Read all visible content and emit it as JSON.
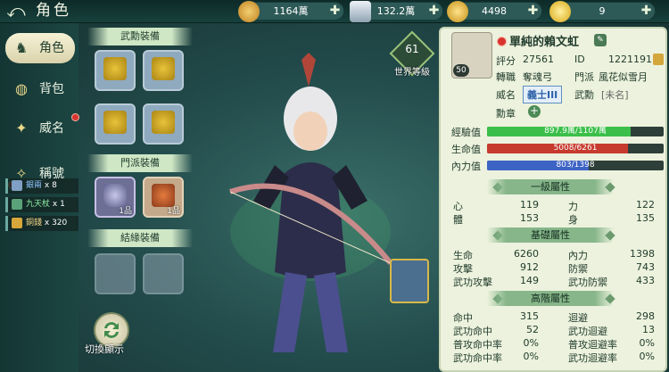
{
  "header": {
    "back_glyph": "⤺",
    "title": "角色"
  },
  "currencies": [
    {
      "name": "coin",
      "value": "1164萬",
      "color": "#e0a23a"
    },
    {
      "name": "silver",
      "value": "132.2萬",
      "color": "#c5d2dc"
    },
    {
      "name": "gold-ingot",
      "value": "4498",
      "color": "#e6b52c"
    },
    {
      "name": "yuanbao",
      "value": "9",
      "color": "#f2c12c"
    }
  ],
  "nav": [
    {
      "label": "角色",
      "icon": "person-icon",
      "glyph": "♞",
      "active": true
    },
    {
      "label": "背包",
      "icon": "bag-icon",
      "glyph": "◍"
    },
    {
      "label": "威名",
      "icon": "fame-icon",
      "glyph": "✦",
      "badge": true
    },
    {
      "label": "稱號",
      "icon": "title-icon",
      "glyph": "✧"
    }
  ],
  "loot": [
    {
      "name": "銀兩",
      "qty": "x 8",
      "color": "#7fa0c4"
    },
    {
      "name": "九天杖",
      "qty": "x 1",
      "color": "#5aa37a"
    },
    {
      "name": "銅錢",
      "qty": "x 320",
      "color": "#d8a63a"
    }
  ],
  "equipment": {
    "martial_title": "武勳裝備",
    "sect_title": "門派裝備",
    "bond_title": "結緣裝備",
    "sect_counts": [
      "1品",
      "1品"
    ],
    "switch_label": "切換顯示"
  },
  "world_level": {
    "value": "61",
    "label": "世界等級"
  },
  "profile": {
    "name": "單純的賴文虹",
    "level": "50",
    "score_label": "評分",
    "score": "27561",
    "id_label": "ID",
    "id": "1221191",
    "job_label": "轉職",
    "job": "奪魂弓",
    "sect_label": "門派",
    "sect": "風花似雪月",
    "fame_label": "威名",
    "fame": "義士III",
    "martial_label": "武勳",
    "martial": "[未名]",
    "medal_label": "勳章"
  },
  "bars": [
    {
      "label": "經驗值",
      "text": "897.9萬/1107萬",
      "ratio": 0.811,
      "color": "#3bbf4a"
    },
    {
      "label": "生命值",
      "text": "5008/6261",
      "ratio": 0.8,
      "color": "#c73a2e"
    },
    {
      "label": "內力值",
      "text": "803/1398",
      "ratio": 0.574,
      "color": "#3d63c4"
    }
  ],
  "sections": [
    {
      "title": "一級屬性",
      "rows": [
        [
          "心",
          "119",
          "力",
          "122"
        ],
        [
          "體",
          "153",
          "身",
          "135"
        ]
      ]
    },
    {
      "title": "基礎屬性",
      "rows": [
        [
          "生命",
          "6260",
          "內力",
          "1398"
        ],
        [
          "攻擊",
          "912",
          "防禦",
          "743"
        ],
        [
          "武功攻擊",
          "149",
          "武功防禦",
          "433"
        ]
      ]
    },
    {
      "title": "高階屬性",
      "rows": [
        [
          "命中",
          "315",
          "迴避",
          "298"
        ],
        [
          "武功命中",
          "52",
          "武功迴避",
          "13"
        ],
        [
          "普攻命中率",
          "0%",
          "普攻迴避率",
          "0%"
        ],
        [
          "武功命中率",
          "0%",
          "武功迴避率",
          "0%"
        ]
      ]
    }
  ]
}
